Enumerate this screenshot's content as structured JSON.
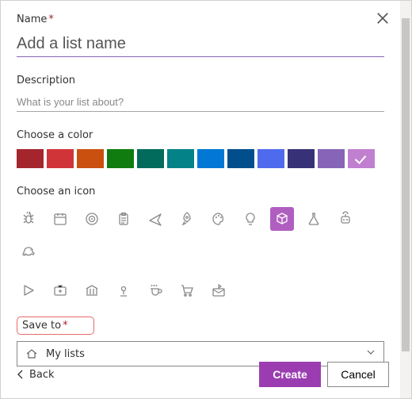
{
  "labels": {
    "name": "Name",
    "description": "Description",
    "choose_color": "Choose a color",
    "choose_icon": "Choose an icon",
    "save_to": "Save to",
    "required_mark": "*"
  },
  "fields": {
    "name_value": "",
    "name_placeholder": "Add a list name",
    "description_value": "",
    "description_placeholder": "What is your list about?",
    "save_to_value": "My lists"
  },
  "colors": [
    {
      "name": "dark-red",
      "hex": "#a4262c",
      "selected": false
    },
    {
      "name": "red",
      "hex": "#d13438",
      "selected": false
    },
    {
      "name": "orange",
      "hex": "#ca5010",
      "selected": false
    },
    {
      "name": "green",
      "hex": "#107c10",
      "selected": false
    },
    {
      "name": "dark-green",
      "hex": "#026b5b",
      "selected": false
    },
    {
      "name": "teal",
      "hex": "#038387",
      "selected": false
    },
    {
      "name": "blue",
      "hex": "#0078d4",
      "selected": false
    },
    {
      "name": "dark-blue",
      "hex": "#004e8c",
      "selected": false
    },
    {
      "name": "indigo",
      "hex": "#4f6bed",
      "selected": false
    },
    {
      "name": "navy",
      "hex": "#373277",
      "selected": false
    },
    {
      "name": "purple",
      "hex": "#8764b8",
      "selected": false
    },
    {
      "name": "pink",
      "hex": "#c17fcf",
      "selected": true
    }
  ],
  "icons_row1": [
    "bug",
    "calendar",
    "target",
    "clipboard",
    "airplane",
    "rocket",
    "palette",
    "lightbulb",
    "cube",
    "flask",
    "robot",
    "piggybank"
  ],
  "icons_row2": [
    "play",
    "firstaid",
    "bank",
    "location",
    "coffee",
    "cart",
    "mail"
  ],
  "selected_icon": "cube",
  "buttons": {
    "back": "Back",
    "create": "Create",
    "cancel": "Cancel"
  }
}
